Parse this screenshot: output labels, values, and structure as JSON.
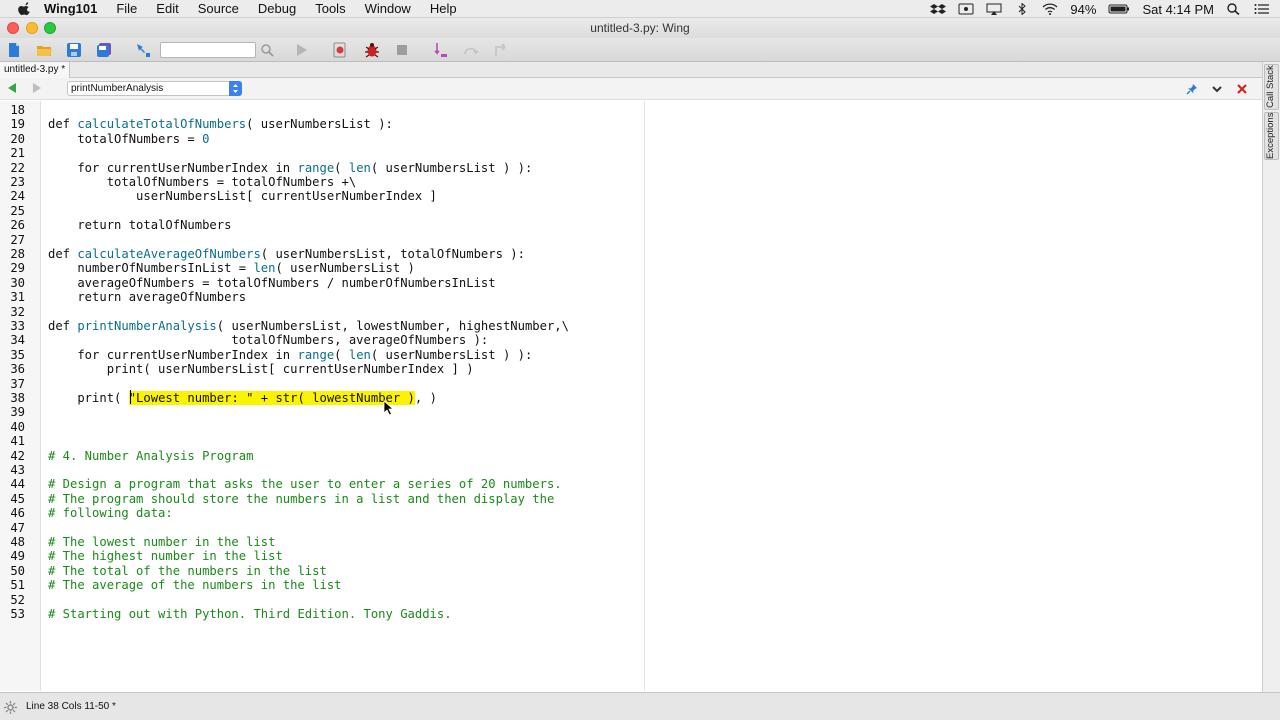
{
  "menubar": {
    "app_name": "Wing101",
    "items": [
      "File",
      "Edit",
      "Source",
      "Debug",
      "Tools",
      "Window",
      "Help"
    ],
    "battery": "94%",
    "clock": "Sat 4:14 PM"
  },
  "window": {
    "title": "untitled-3.py: Wing"
  },
  "toolbar": {
    "search_value": ""
  },
  "tabs": {
    "file_tab": "untitled-3.py *"
  },
  "nav": {
    "function_select": "printNumberAnalysis"
  },
  "side_tabs": {
    "call_stack": "Call Stack",
    "exceptions": "Exceptions"
  },
  "editor": {
    "lines": [
      {
        "n": "18",
        "text": ""
      },
      {
        "n": "19",
        "text": "def calculateTotalOfNumbers( userNumbersList ):"
      },
      {
        "n": "20",
        "text": "    totalOfNumbers = 0"
      },
      {
        "n": "21",
        "text": ""
      },
      {
        "n": "22",
        "text": "    for currentUserNumberIndex in range( len( userNumbersList ) ):"
      },
      {
        "n": "23",
        "text": "        totalOfNumbers = totalOfNumbers +\\"
      },
      {
        "n": "24",
        "text": "            userNumbersList[ currentUserNumberIndex ]"
      },
      {
        "n": "25",
        "text": ""
      },
      {
        "n": "26",
        "text": "    return totalOfNumbers"
      },
      {
        "n": "27",
        "text": ""
      },
      {
        "n": "28",
        "text": "def calculateAverageOfNumbers( userNumbersList, totalOfNumbers ):"
      },
      {
        "n": "29",
        "text": "    numberOfNumbersInList = len( userNumbersList )"
      },
      {
        "n": "30",
        "text": "    averageOfNumbers = totalOfNumbers / numberOfNumbersInList"
      },
      {
        "n": "31",
        "text": "    return averageOfNumbers"
      },
      {
        "n": "32",
        "text": ""
      },
      {
        "n": "33",
        "text": "def printNumberAnalysis( userNumbersList, lowestNumber, highestNumber,\\"
      },
      {
        "n": "34",
        "text": "                         totalOfNumbers, averageOfNumbers ):"
      },
      {
        "n": "35",
        "text": "    for currentUserNumberIndex in range( len( userNumbersList ) ):"
      },
      {
        "n": "36",
        "text": "        print( userNumbersList[ currentUserNumberIndex ] )"
      },
      {
        "n": "37",
        "text": ""
      },
      {
        "n": "38",
        "text": "    print( \"Lowest number: \" + str( lowestNumber ), )"
      },
      {
        "n": "39",
        "text": ""
      },
      {
        "n": "40",
        "text": ""
      },
      {
        "n": "41",
        "text": ""
      },
      {
        "n": "42",
        "text": "# 4. Number Analysis Program"
      },
      {
        "n": "43",
        "text": ""
      },
      {
        "n": "44",
        "text": "# Design a program that asks the user to enter a series of 20 numbers."
      },
      {
        "n": "45",
        "text": "# The program should store the numbers in a list and then display the"
      },
      {
        "n": "46",
        "text": "# following data:"
      },
      {
        "n": "47",
        "text": ""
      },
      {
        "n": "48",
        "text": "# The lowest number in the list"
      },
      {
        "n": "49",
        "text": "# The highest number in the list"
      },
      {
        "n": "50",
        "text": "# The total of the numbers in the list"
      },
      {
        "n": "51",
        "text": "# The average of the numbers in the list"
      },
      {
        "n": "52",
        "text": ""
      },
      {
        "n": "53",
        "text": "# Starting out with Python. Third Edition. Tony Gaddis."
      }
    ],
    "selection": "\"Lowest number: \" + str( lowestNumber )"
  },
  "status": {
    "text": "Line 38 Cols 11-50 *"
  }
}
